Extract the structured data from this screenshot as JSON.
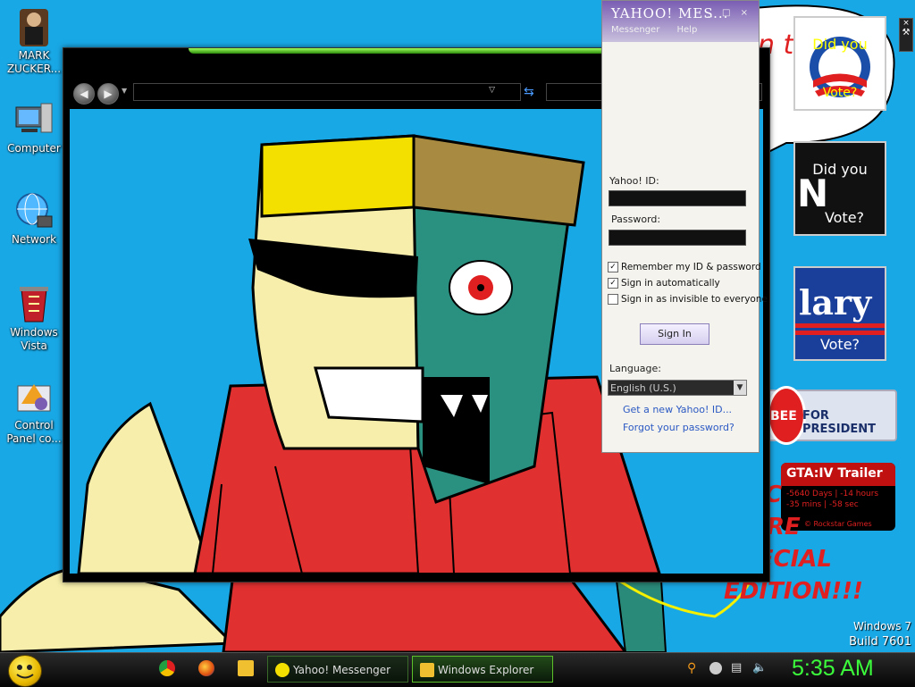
{
  "desktop": {
    "icons": [
      {
        "label": "MARK ZUCKER...",
        "icon": "person-icon"
      },
      {
        "label": "Computer",
        "icon": "computer-icon"
      },
      {
        "label": "Network",
        "icon": "network-globe-icon"
      },
      {
        "label": "Windows Vista",
        "icon": "recycle-bin-icon"
      },
      {
        "label": "Control Panel co...",
        "icon": "control-panel-icon"
      }
    ],
    "gadgets": {
      "vote1": {
        "line1": "Did you",
        "line2": "Vote?"
      },
      "vote2": {
        "line1": "Did you",
        "line2": "Vote?",
        "letter": "N"
      },
      "vote3": {
        "word": "lary",
        "line2": "Vote?"
      },
      "huckabee": {
        "prefix": "BEE",
        "text": "FOR PRESIDENT"
      },
      "gta": {
        "title": "GTA:IV Trailer",
        "line1": "-5640 Days | -14 hours",
        "line2": "-35 mins | -58 sec",
        "footer": "© Rockstar Games"
      }
    },
    "wallpaper_text": [
      "VMC",
      "MORE",
      "SPECIAL",
      "EDITION!!!"
    ],
    "watermark": {
      "os": "Windows 7",
      "build": "Build 7601"
    }
  },
  "explorer": {
    "back_icon": "back-arrow-icon",
    "forward_icon": "forward-arrow-icon",
    "address_value": "",
    "search_value": ""
  },
  "yahoo": {
    "logo": "YAHOO! MES...",
    "menu": [
      "Messenger",
      "Help"
    ],
    "id_label": "Yahoo! ID:",
    "id_value": "",
    "password_label": "Password:",
    "password_value": "",
    "options": [
      {
        "label": "Remember my ID & password",
        "checked": true
      },
      {
        "label": "Sign in automatically",
        "checked": true
      },
      {
        "label": "Sign in as invisible to everyone",
        "checked": false
      }
    ],
    "signin_label": "Sign In",
    "language_label": "Language:",
    "language_value": "English (U.S.)",
    "links": [
      "Get a new Yahoo! ID...",
      "Forgot your password?"
    ]
  },
  "taskbar": {
    "quick_launch": [
      "chrome-icon",
      "firefox-icon",
      "folder-icon"
    ],
    "buttons": [
      {
        "label": "Yahoo! Messenger",
        "icon": "yahoo-smiley-icon"
      },
      {
        "label": "Windows Explorer",
        "icon": "explorer-icon"
      }
    ],
    "tray": [
      "search-icon",
      "circle-status-icon",
      "network-tray-icon",
      "volume-icon"
    ],
    "clock": "5:35 AM"
  },
  "colors": {
    "accent": "#3cff3c",
    "wallpaper": "#19a8e6",
    "yahoo_purple": "#7a5db3"
  }
}
